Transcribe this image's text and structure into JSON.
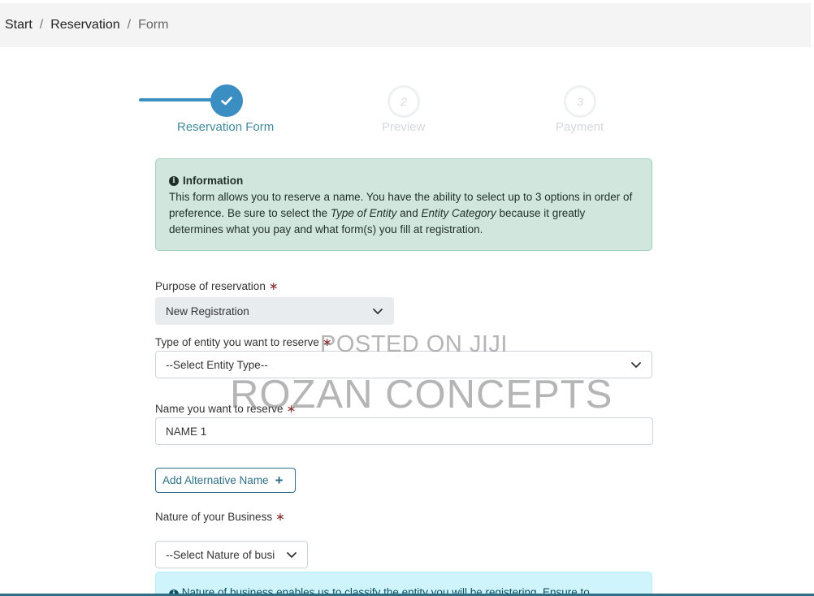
{
  "breadcrumb": {
    "items": [
      "Start",
      "Reservation",
      "Form"
    ],
    "separator": "/"
  },
  "stepper": {
    "steps": [
      {
        "number": "",
        "label": "Reservation Form",
        "state": "completed"
      },
      {
        "number": "2",
        "label": "Preview",
        "state": "pending"
      },
      {
        "number": "3",
        "label": "Payment",
        "state": "pending"
      }
    ],
    "accent_color": "#3b8ec2"
  },
  "info_alert": {
    "title": "Information",
    "text_1": "This form allows you to reserve a name. You have the ability to select up to 3 options in order of preference. Be sure to select the ",
    "em_1": "Type of Entity",
    "text_2": " and ",
    "em_2": "Entity Category",
    "text_3": " because it greatly determines what you pay and what form(s) you fill at registration."
  },
  "form": {
    "purpose": {
      "label": "Purpose of reservation",
      "required_mark": "∗",
      "value": "New Registration"
    },
    "entity_type": {
      "label": "Type of entity you want to reserve",
      "required_mark": "∗",
      "value": "--Select Entity Type--"
    },
    "name": {
      "label": "Name you want to reserve",
      "required_mark": "∗",
      "value": "NAME 1"
    },
    "add_alternative_label": "Add Alternative Name",
    "nature": {
      "label": "Nature of your Business",
      "required_mark": "∗",
      "value": "--Select Nature of busi"
    }
  },
  "nature_alert": {
    "text": "Nature of business enables us to classify the entity you will be registering. Ensure to"
  },
  "watermark": {
    "line_1": "POSTED ON JIJI",
    "line_2": "ROZAN CONCEPTS"
  }
}
